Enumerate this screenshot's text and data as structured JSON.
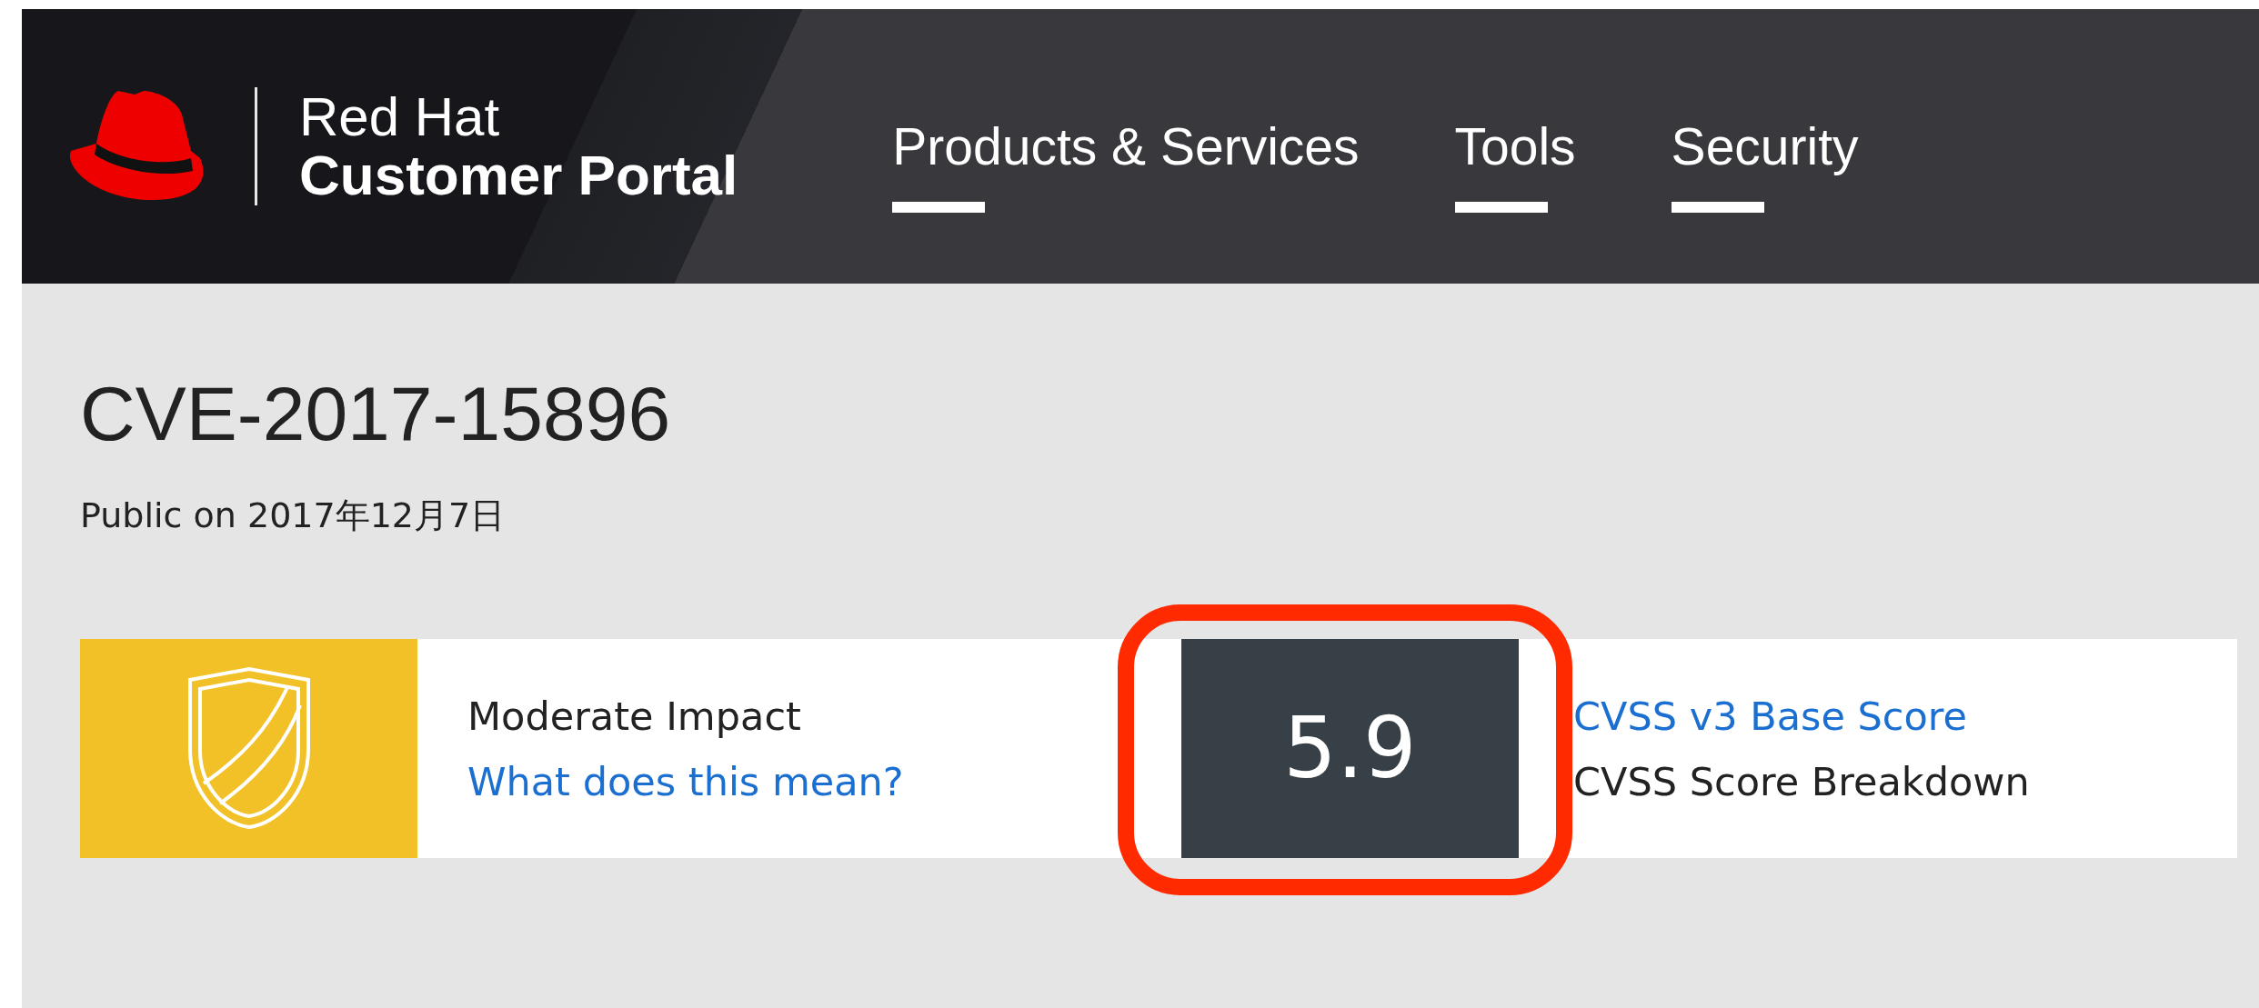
{
  "header": {
    "brand_line_1": "Red Hat",
    "brand_line_2": "Customer Portal",
    "nav": [
      {
        "label": "Products & Services"
      },
      {
        "label": "Tools"
      },
      {
        "label": "Security"
      }
    ]
  },
  "cve": {
    "title": "CVE-2017-15896",
    "published": "Public on 2017年12月7日"
  },
  "impact": {
    "label": "Moderate Impact",
    "link": "What does this mean?"
  },
  "score": {
    "value": "5.9",
    "link": "CVSS v3 Base Score",
    "breakdown": "CVSS Score Breakdown"
  }
}
